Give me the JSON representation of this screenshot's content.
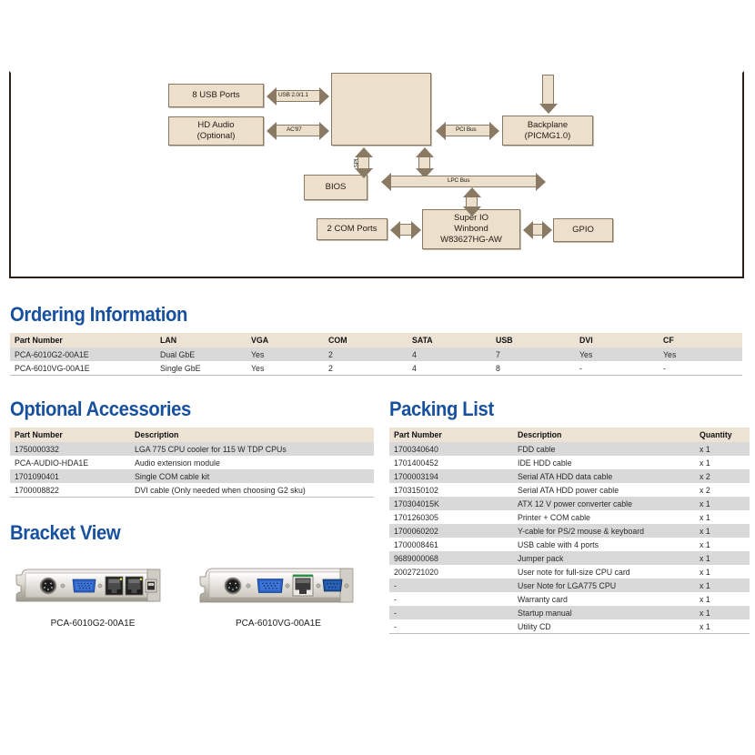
{
  "diagram": {
    "boxes": [
      {
        "name": "usb-ports-block",
        "label": "8 USB Ports"
      },
      {
        "name": "hd-audio-block",
        "label": "HD Audio\n(Optional)"
      },
      {
        "name": "chipset-block",
        "label": ""
      },
      {
        "name": "backplane-block",
        "label": "Backplane\n(PICMG1.0)"
      },
      {
        "name": "bios-block",
        "label": "BIOS"
      },
      {
        "name": "com-ports-block",
        "label": "2 COM Ports"
      },
      {
        "name": "super-io-block",
        "label": "Super IO\nWinbond\nW83627HG-AW"
      },
      {
        "name": "gpio-block",
        "label": "GPIO"
      }
    ],
    "bus_labels": {
      "usb": "USB 2.0/1.1",
      "audio": "AC'97",
      "pci": "PCI Bus",
      "spi": "SPI",
      "lpc": "LPC Bus"
    },
    "box_fill": "#ece0cc",
    "box_stroke": "#8a7a63",
    "frame_stroke": "#2b2118"
  },
  "ordering": {
    "heading": "Ordering Information",
    "columns": [
      "Part Number",
      "LAN",
      "VGA",
      "COM",
      "SATA",
      "USB",
      "DVI",
      "CF"
    ],
    "rows": [
      [
        "PCA-6010G2-00A1E",
        "Dual GbE",
        "Yes",
        "2",
        "4",
        "7",
        "Yes",
        "Yes"
      ],
      [
        "PCA-6010VG-00A1E",
        "Single GbE",
        "Yes",
        "2",
        "4",
        "8",
        "-",
        "-"
      ]
    ]
  },
  "optional_accessories": {
    "heading": "Optional Accessories",
    "columns": [
      "Part Number",
      "Description"
    ],
    "rows": [
      [
        "1750000332",
        "LGA 775 CPU cooler for 115 W TDP CPUs"
      ],
      [
        "PCA-AUDIO-HDA1E",
        "Audio extension module"
      ],
      [
        "1701090401",
        "Single COM cable kit"
      ],
      [
        "1700008822",
        "DVI cable (Only needed when choosing G2 sku)"
      ]
    ]
  },
  "packing_list": {
    "heading": "Packing List",
    "columns": [
      "Part Number",
      "Description",
      "Quantity"
    ],
    "rows": [
      [
        "1700340640",
        "FDD cable",
        "x 1"
      ],
      [
        "1701400452",
        "IDE HDD cable",
        "x 1"
      ],
      [
        "1700003194",
        "Serial ATA HDD data cable",
        "x 2"
      ],
      [
        "1703150102",
        "Serial ATA HDD power cable",
        "x 2"
      ],
      [
        "170304015K",
        "ATX 12 V power converter cable",
        "x 1"
      ],
      [
        "1701260305",
        "Printer + COM cable",
        "x 1"
      ],
      [
        "1700060202",
        "Y-cable for PS/2 mouse & keyboard",
        "x 1"
      ],
      [
        "1700008461",
        "USB cable with 4 ports",
        "x 1"
      ],
      [
        "9689000068",
        "Jumper pack",
        "x 1"
      ],
      [
        "2002721020",
        "User note for full-size CPU card",
        "x 1"
      ],
      [
        "-",
        "User Note for LGA775 CPU",
        "x 1"
      ],
      [
        "-",
        "Warranty card",
        "x 1"
      ],
      [
        "-",
        "Startup manual",
        "x 1"
      ],
      [
        "-",
        "Utility CD",
        "x 1"
      ]
    ]
  },
  "bracket_view": {
    "heading": "Bracket View",
    "brackets": [
      {
        "label": "PCA-6010G2-00A1E",
        "ports": [
          "ps2",
          "vga",
          "rj45",
          "rj45",
          "usb"
        ]
      },
      {
        "label": "PCA-6010VG-00A1E",
        "ports": [
          "ps2",
          "vga",
          "rj45",
          "db9"
        ]
      }
    ]
  },
  "colors": {
    "heading_blue": "#17509e",
    "table_header_bg": "#ece3d5",
    "row_alt_bg": "#d9d9d9"
  }
}
